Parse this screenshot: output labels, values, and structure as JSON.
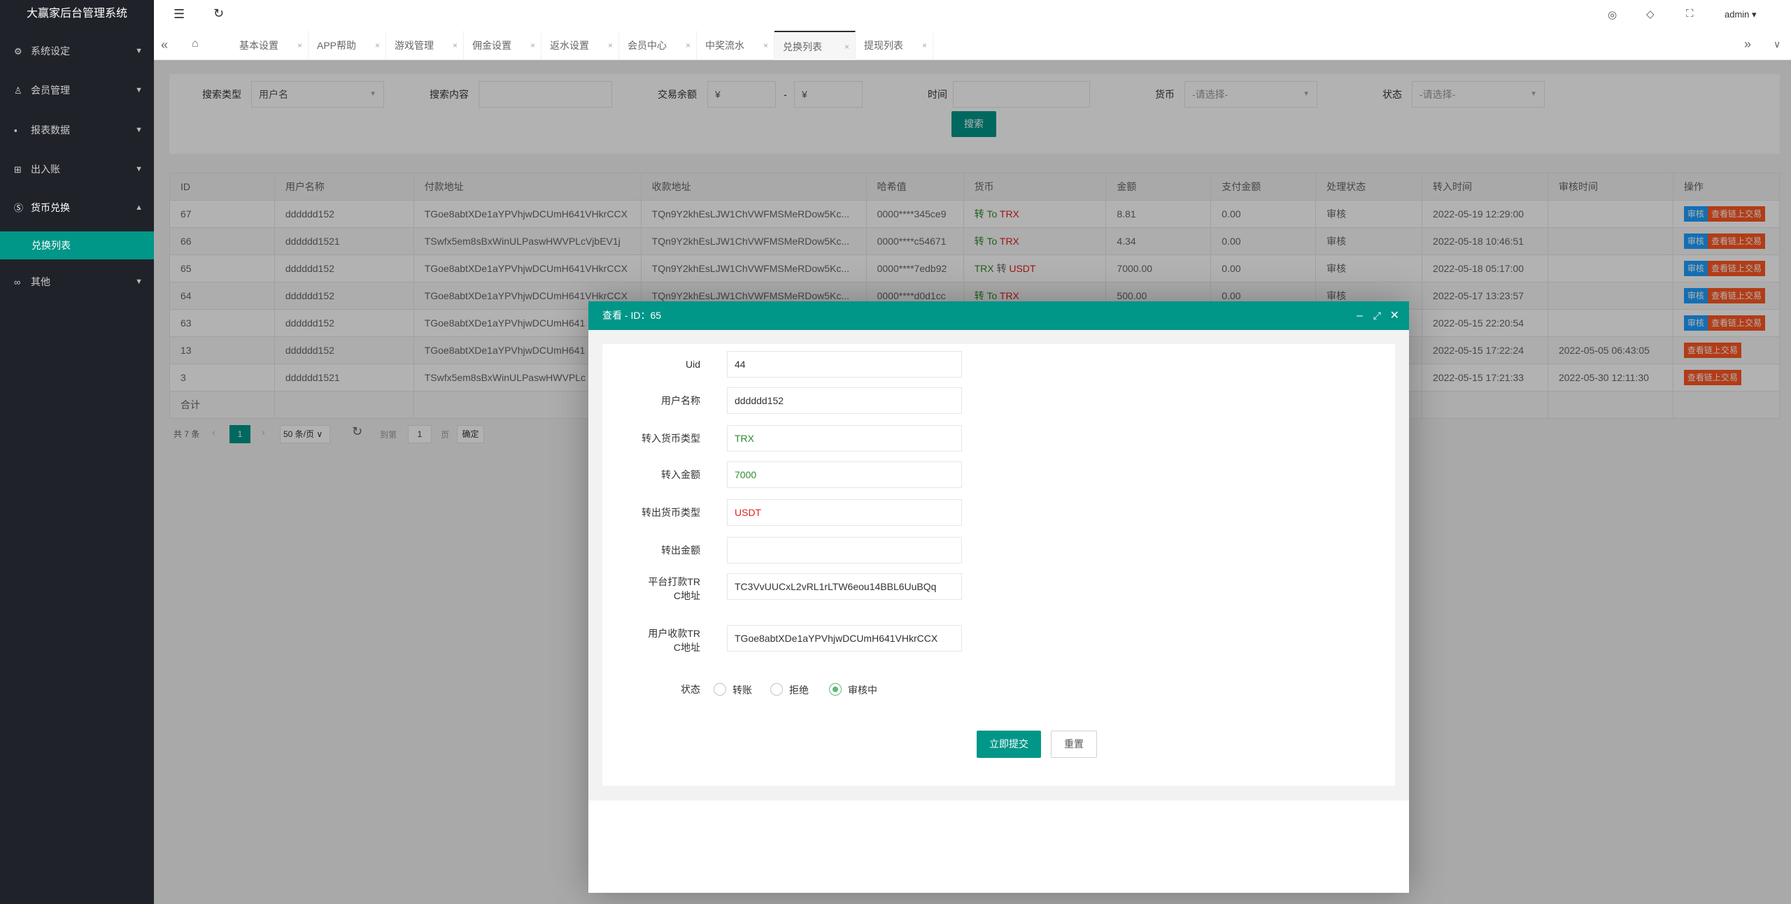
{
  "app_title": "大赢家后台管理系统",
  "sidebar": {
    "items": [
      {
        "label": "系统设定",
        "icon": "gear-icon"
      },
      {
        "label": "会员管理",
        "icon": "user-icon"
      },
      {
        "label": "报表数据",
        "icon": "report-icon"
      },
      {
        "label": "出入账",
        "icon": "book-icon"
      },
      {
        "label": "货币兑换",
        "icon": "dollar-icon",
        "expanded": true
      },
      {
        "label": "其他",
        "icon": "link-icon"
      }
    ],
    "sub_active": "兑换列表"
  },
  "header": {
    "user": "admin"
  },
  "tabs": [
    "基本设置",
    "APP帮助",
    "游戏管理",
    "佣金设置",
    "返水设置",
    "会员中心",
    "中奖流水",
    "兑换列表",
    "提现列表"
  ],
  "active_tab": "兑换列表",
  "search": {
    "type_label": "搜索类型",
    "type_value": "用户名",
    "content_label": "搜索内容",
    "balance_label": "交易余额",
    "yen": "¥",
    "dash": "-",
    "time_label": "时间",
    "currency_label": "货币",
    "currency_placeholder": "-请选择-",
    "status_label": "状态",
    "status_placeholder": "-请选择-",
    "button": "搜索"
  },
  "table": {
    "headers": [
      "ID",
      "用户名称",
      "付款地址",
      "收款地址",
      "哈希值",
      "货币",
      "金额",
      "支付金额",
      "处理状态",
      "转入时间",
      "审核时间",
      "操作"
    ],
    "rows": [
      {
        "id": "67",
        "user": "dddddd152",
        "pay": "TGoe8abtXDe1aYPVhjwDCUmH641VHkrCCX",
        "recv": "TQn9Y2khEsLJW1ChVWFMSMeRDow5Kc...",
        "hash": "0000****345ce9",
        "cur": [
          "转",
          "To",
          "TRX"
        ],
        "amount": "8.81",
        "paid": "0.00",
        "status": "审核",
        "in_time": "2022-05-19 12:29:00",
        "audit_time": "",
        "ops": [
          "审核",
          "查看链上交易"
        ]
      },
      {
        "id": "66",
        "user": "dddddd1521",
        "pay": "TSwfx5em8sBxWinULPaswHWVPLcVjbEV1j",
        "recv": "TQn9Y2khEsLJW1ChVWFMSMeRDow5Kc...",
        "hash": "0000****c54671",
        "cur": [
          "转",
          "To",
          "TRX"
        ],
        "amount": "4.34",
        "paid": "0.00",
        "status": "审核",
        "in_time": "2022-05-18 10:46:51",
        "audit_time": "",
        "ops": [
          "审核",
          "查看链上交易"
        ]
      },
      {
        "id": "65",
        "user": "dddddd152",
        "pay": "TGoe8abtXDe1aYPVhjwDCUmH641VHkrCCX",
        "recv": "TQn9Y2khEsLJW1ChVWFMSMeRDow5Kc...",
        "hash": "0000****7edb92",
        "cur": [
          "TRX",
          "转",
          "USDT"
        ],
        "amount": "7000.00",
        "paid": "0.00",
        "status": "审核",
        "in_time": "2022-05-18 05:17:00",
        "audit_time": "",
        "ops": [
          "审核",
          "查看链上交易"
        ]
      },
      {
        "id": "64",
        "user": "dddddd152",
        "pay": "TGoe8abtXDe1aYPVhjwDCUmH641VHkrCCX",
        "recv": "TQn9Y2khEsLJW1ChVWFMSMeRDow5Kc...",
        "hash": "0000****d0d1cc",
        "cur": [
          "转",
          "To",
          "TRX"
        ],
        "amount": "500.00",
        "paid": "0.00",
        "status": "审核",
        "in_time": "2022-05-17 13:23:57",
        "audit_time": "",
        "ops": [
          "审核",
          "查看链上交易"
        ]
      },
      {
        "id": "63",
        "user": "dddddd152",
        "pay": "TGoe8abtXDe1aYPVhjwDCUmH641",
        "recv": "",
        "hash": "",
        "cur": [
          "",
          "",
          ""
        ],
        "amount": "",
        "paid": "",
        "status": "",
        "in_time": "2022-05-15 22:20:54",
        "audit_time": "",
        "ops": [
          "审核",
          "查看链上交易"
        ]
      },
      {
        "id": "13",
        "user": "dddddd152",
        "pay": "TGoe8abtXDe1aYPVhjwDCUmH641",
        "recv": "",
        "hash": "",
        "cur": [
          "",
          "",
          ""
        ],
        "amount": "",
        "paid": "",
        "status": "",
        "in_time": "2022-05-15 17:22:24",
        "audit_time": "2022-05-05 06:43:05",
        "ops": [
          "查看链上交易"
        ]
      },
      {
        "id": "3",
        "user": "dddddd1521",
        "pay": "TSwfx5em8sBxWinULPaswHWVPLc",
        "recv": "",
        "hash": "",
        "cur": [
          "",
          "",
          ""
        ],
        "amount": "",
        "paid": "",
        "status": "",
        "in_time": "2022-05-15 17:21:33",
        "audit_time": "2022-05-30 12:11:30",
        "ops": [
          "查看链上交易"
        ]
      }
    ],
    "total_label": "合计"
  },
  "pager": {
    "total": "共 7 条",
    "page": "1",
    "per_page": "50 条/页",
    "goto": "到第",
    "goto_value": "1",
    "page_unit": "页",
    "confirm": "确定"
  },
  "modal": {
    "title": "查看 - ID：65",
    "fields": [
      {
        "label": "Uid",
        "value": "44",
        "color": ""
      },
      {
        "label": "用户名称",
        "value": "dddddd152",
        "color": ""
      },
      {
        "label": "转入货币类型",
        "value": "TRX",
        "color": "#2e8b2e"
      },
      {
        "label": "转入金额",
        "value": "7000",
        "color": "#2e8b2e"
      },
      {
        "label": "转出货币类型",
        "value": "USDT",
        "color": "#e02020"
      },
      {
        "label": "转出金额",
        "value": "",
        "color": ""
      },
      {
        "label": "平台打款TRC地址",
        "value": "TC3VvUUCxL2vRL1rLTW6eou14BBL6UuBQq",
        "color": ""
      },
      {
        "label": "用户收款TRC地址",
        "value": "TGoe8abtXDe1aYPVhjwDCUmH641VHkrCCX",
        "color": ""
      }
    ],
    "status_label": "状态",
    "status_options": [
      "转账",
      "拒绝",
      "审核中"
    ],
    "status_selected": "审核中",
    "submit": "立即提交",
    "reset": "重置"
  },
  "colors": {
    "primary": "#009688",
    "blue": "#1E9FFF",
    "orange": "#FF5722",
    "sidebar": "#20222a"
  }
}
